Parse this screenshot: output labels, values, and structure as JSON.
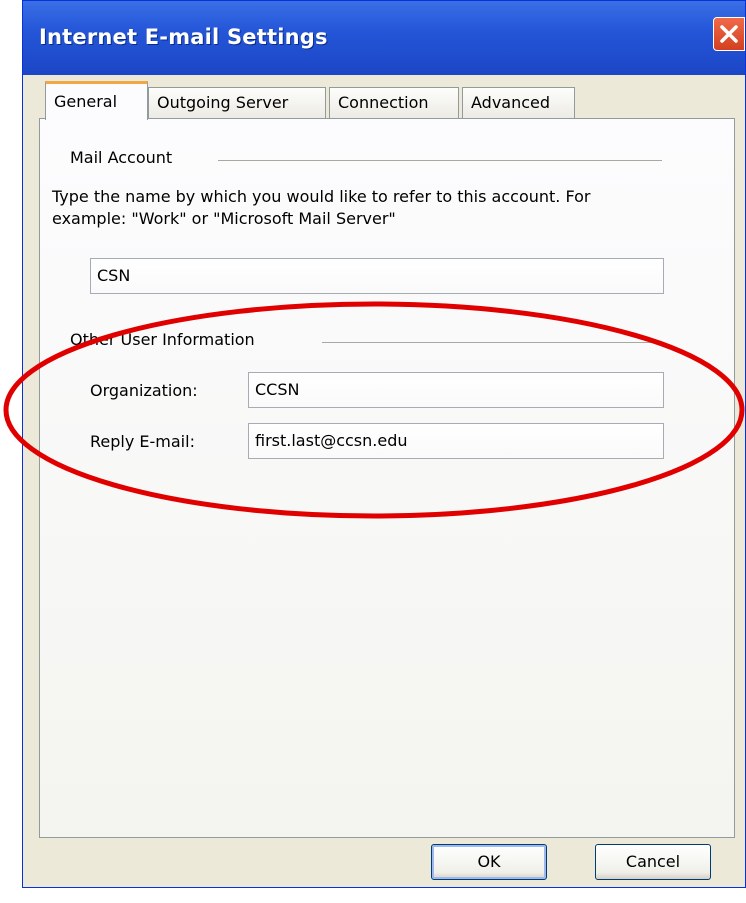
{
  "window": {
    "title": "Internet E-mail Settings",
    "close_icon": "close-icon"
  },
  "tabs": [
    {
      "label": "General",
      "active": true
    },
    {
      "label": "Outgoing Server",
      "active": false
    },
    {
      "label": "Connection",
      "active": false
    },
    {
      "label": "Advanced",
      "active": false
    }
  ],
  "mail_account": {
    "heading": "Mail Account",
    "description": "Type the name by which you would like to refer to this account.  For example: \"Work\" or \"Microsoft Mail Server\"",
    "account_name": "CSN"
  },
  "other_user_info": {
    "heading": "Other User Information",
    "organization_label": "Organization:",
    "organization_value": "CCSN",
    "reply_email_label": "Reply E-mail:",
    "reply_email_value": "first.last@ccsn.edu"
  },
  "buttons": {
    "ok_label": "OK",
    "cancel_label": "Cancel"
  },
  "colors": {
    "titlebar": "#2456d8",
    "dialog_bg": "#ece9d8",
    "annotation_ellipse": "#e00000",
    "active_tab_accent": "#f1a844"
  }
}
